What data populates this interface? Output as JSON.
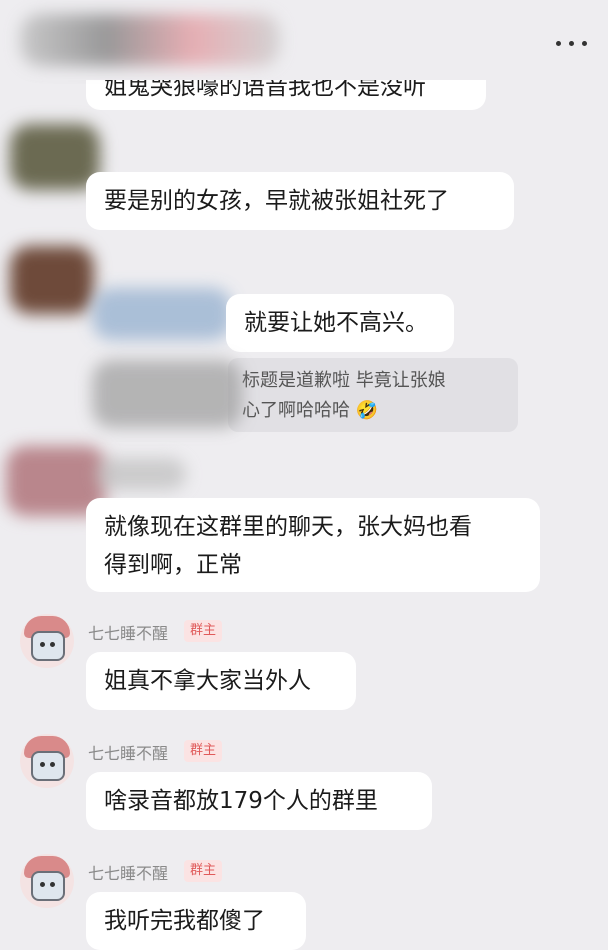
{
  "messages": {
    "m0": "姐鬼哭狼嚎的语音我也不是没听",
    "m1": "要是别的女孩，早就被张姐社死了",
    "m2": "就要让她不高兴。",
    "quote_line1": "标题是道歉啦 毕竟让张娘",
    "quote_line2": "心了啊哈哈哈",
    "quote_emoji": "🤣",
    "m3_line1": "就像现在这群里的聊天，张大妈也看",
    "m3_line2": "得到啊，正常",
    "m4": "姐真不拿大家当外人",
    "m5": "啥录音都放179个人的群里",
    "m6": "我听完我都傻了"
  },
  "sender": {
    "name": "七七睡不醒",
    "badge": "群主"
  },
  "icons": {
    "more": "more-dots-icon"
  }
}
